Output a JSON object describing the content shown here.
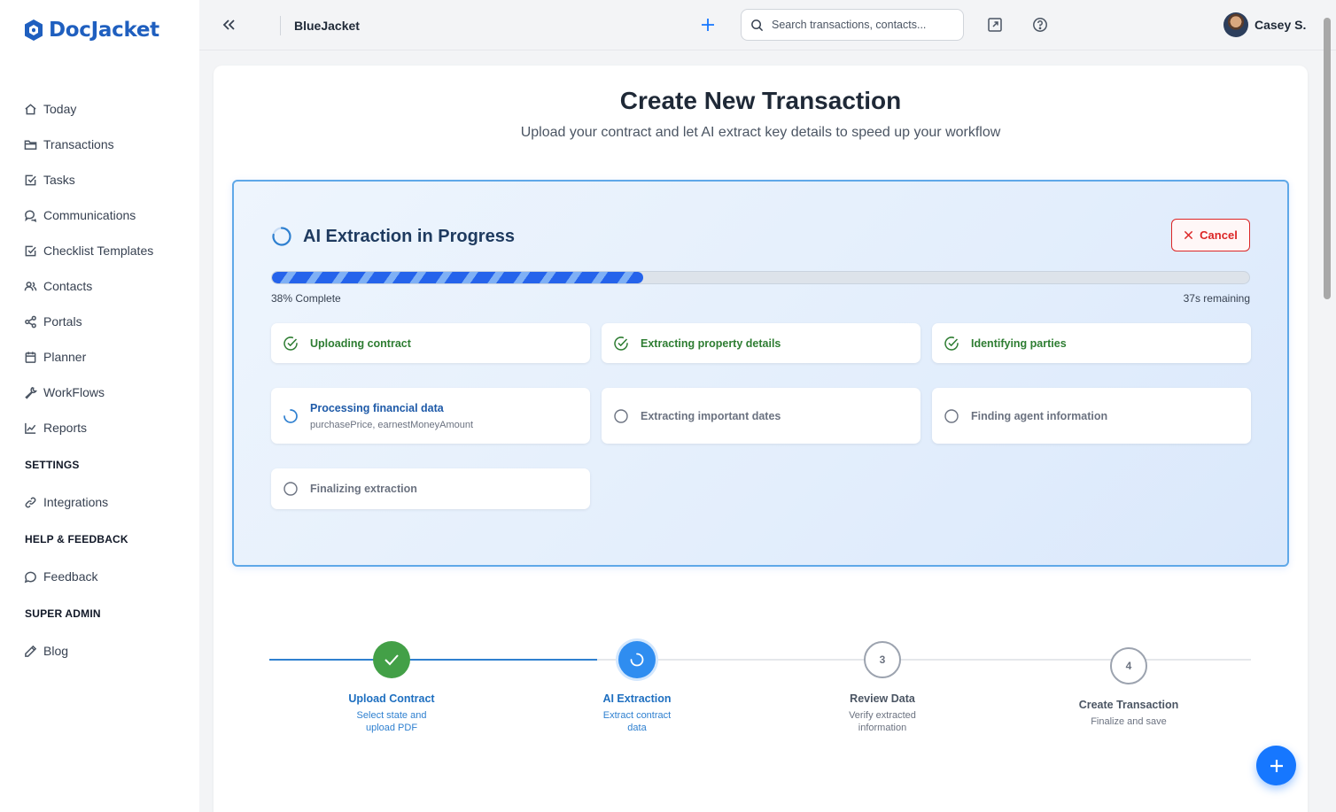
{
  "app": {
    "logo_text": "DocJacket"
  },
  "sidebar": {
    "items": [
      {
        "label": "Today",
        "icon": "home-icon"
      },
      {
        "label": "Transactions",
        "icon": "folder-icon"
      },
      {
        "label": "Tasks",
        "icon": "checkbox-icon"
      },
      {
        "label": "Communications",
        "icon": "chat-icon"
      },
      {
        "label": "Checklist Templates",
        "icon": "checkbox-icon"
      },
      {
        "label": "Contacts",
        "icon": "users-icon"
      },
      {
        "label": "Portals",
        "icon": "share-icon"
      },
      {
        "label": "Planner",
        "icon": "calendar-icon"
      },
      {
        "label": "WorkFlows",
        "icon": "wrench-icon"
      },
      {
        "label": "Reports",
        "icon": "chart-icon"
      }
    ],
    "settings_heading": "SETTINGS",
    "settings_items": [
      {
        "label": "Integrations",
        "icon": "link-icon"
      }
    ],
    "help_heading": "HELP & FEEDBACK",
    "help_items": [
      {
        "label": "Feedback",
        "icon": "message-icon"
      }
    ],
    "admin_heading": "SUPER ADMIN",
    "admin_items": [
      {
        "label": "Blog",
        "icon": "pencil-icon"
      }
    ]
  },
  "topbar": {
    "org_name": "BlueJacket",
    "search_placeholder": "Search transactions, contacts...",
    "user_name": "Casey S."
  },
  "page": {
    "title": "Create New Transaction",
    "subtitle": "Upload your contract and let AI extract key details to speed up your workflow"
  },
  "extraction": {
    "title": "AI Extraction in Progress",
    "cancel_label": "Cancel",
    "progress_percent": 38,
    "progress_label": "38% Complete",
    "remaining_label": "37s remaining",
    "steps": [
      {
        "label": "Uploading contract",
        "status": "done"
      },
      {
        "label": "Extracting property details",
        "status": "done"
      },
      {
        "label": "Identifying parties",
        "status": "done"
      },
      {
        "label": "Processing financial data",
        "status": "active",
        "detail": "purchasePrice, earnestMoneyAmount"
      },
      {
        "label": "Extracting important dates",
        "status": "pending"
      },
      {
        "label": "Finding agent information",
        "status": "pending"
      },
      {
        "label": "Finalizing extraction",
        "status": "pending"
      }
    ]
  },
  "stepper": [
    {
      "number": "1",
      "title": "Upload Contract",
      "desc": "Select state and upload PDF",
      "status": "complete"
    },
    {
      "number": "2",
      "title": "AI Extraction",
      "desc": "Extract contract data",
      "status": "current"
    },
    {
      "number": "3",
      "title": "Review Data",
      "desc": "Verify extracted information",
      "status": "upcoming"
    },
    {
      "number": "4",
      "title": "Create Transaction",
      "desc": "Finalize and save",
      "status": "upcoming"
    }
  ],
  "colors": {
    "accent": "#1677ff",
    "success": "#2e7d32",
    "danger": "#dc2626",
    "panel_border": "#5fa8e8"
  }
}
